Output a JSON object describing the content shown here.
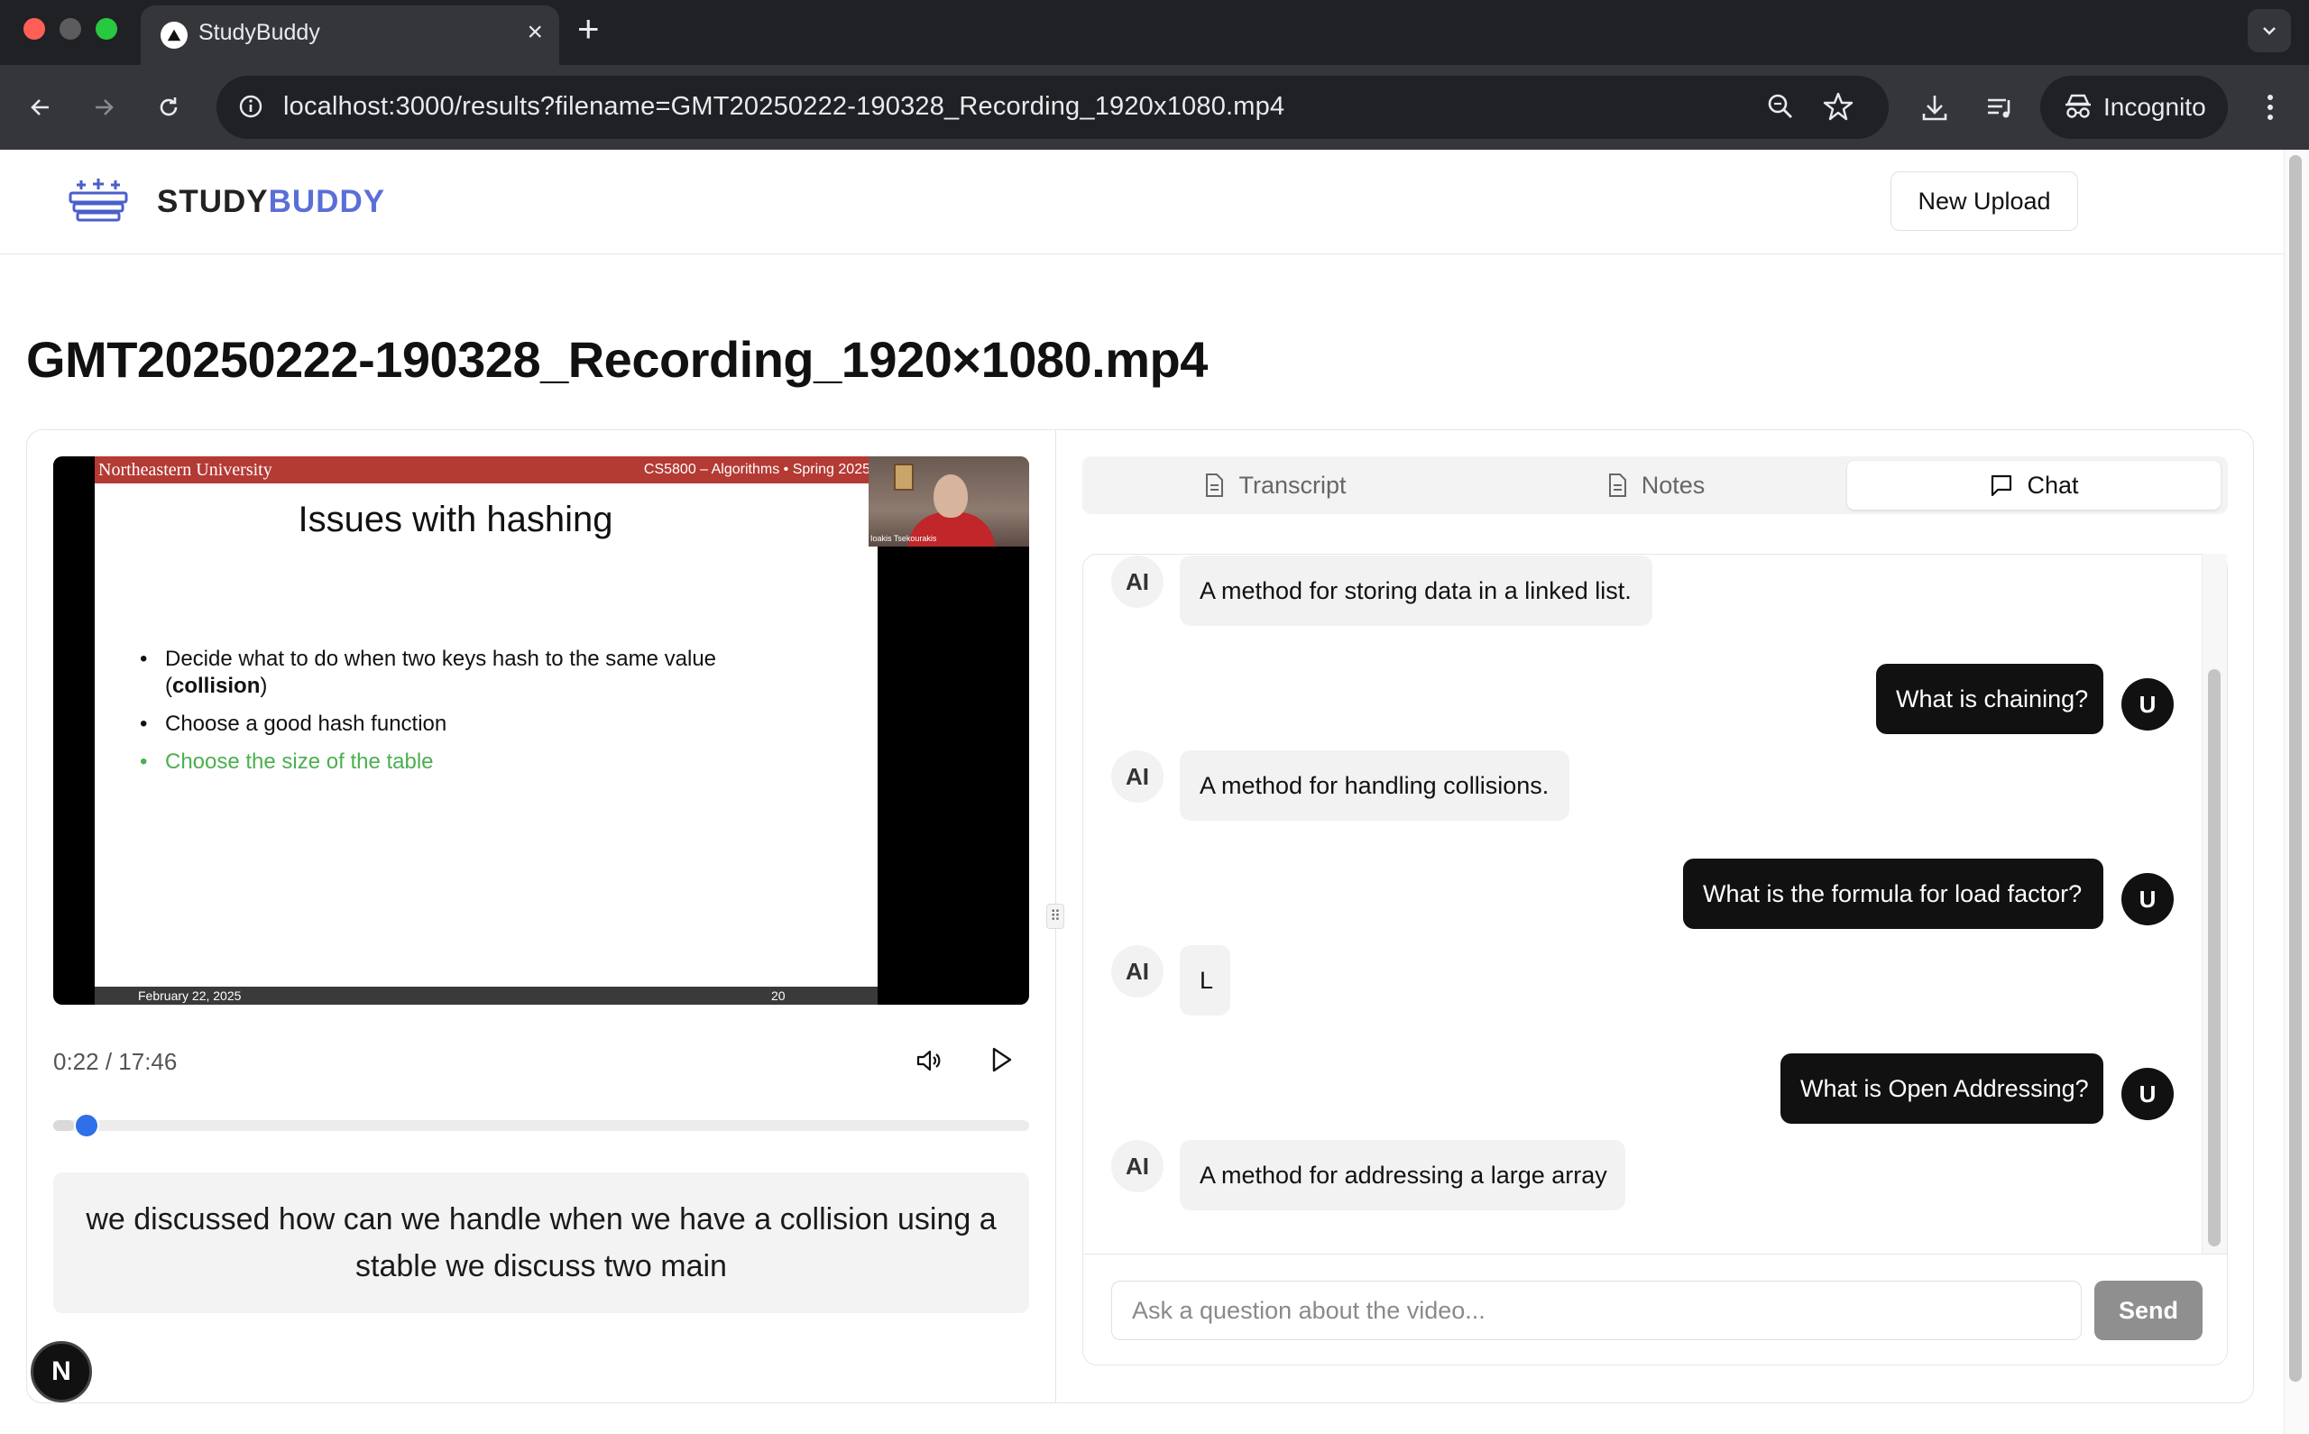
{
  "browser": {
    "tab_title": "StudyBuddy",
    "url": "localhost:3000/results?filename=GMT20250222-190328_Recording_1920x1080.mp4",
    "profile_label": "Incognito"
  },
  "header": {
    "brand_part1": "STUDY",
    "brand_part2": "BUDDY",
    "new_upload_label": "New Upload"
  },
  "page": {
    "title": "GMT20250222-190328_Recording_1920×1080.mp4"
  },
  "video": {
    "slide": {
      "university": "Northeastern University",
      "course": "CS5800 – Algorithms   •   Spring 2025",
      "title": "Issues with hashing",
      "bullet1_prefix": "Decide what to do when two keys hash to the same value (",
      "bullet1_bold": "collision",
      "bullet1_suffix": ")",
      "bullet2": "Choose a good hash function",
      "bullet3": "Choose the size of the table",
      "date": "February 22, 2025",
      "page_number": "20"
    },
    "webcam_label": "Ioakis Tsekourakis",
    "time_display": "0:22 / 17:46",
    "progress_fraction": 0.021,
    "caption": "we discussed how can we handle when we have a collision using a stable we discuss two main"
  },
  "tabs": {
    "transcript": "Transcript",
    "notes": "Notes",
    "chat": "Chat",
    "active": "chat"
  },
  "chat": {
    "messages": [
      {
        "role": "ai",
        "avatar": "AI",
        "text": "A method for storing data in a linked list."
      },
      {
        "role": "user",
        "avatar": "U",
        "text": "What is chaining?"
      },
      {
        "role": "ai",
        "avatar": "AI",
        "text": "A method for handling collisions."
      },
      {
        "role": "user",
        "avatar": "U",
        "text": "What is the formula for load factor?"
      },
      {
        "role": "ai",
        "avatar": "AI",
        "text": "L"
      },
      {
        "role": "user",
        "avatar": "U",
        "text": "What is Open Addressing?"
      },
      {
        "role": "ai",
        "avatar": "AI",
        "text": "A method for addressing a large array"
      }
    ],
    "input_placeholder": "Ask a question about the video...",
    "send_label": "Send"
  },
  "dev_badge": "N",
  "colors": {
    "brand_accent": "#5a6fd6",
    "progress_thumb": "#2f6fe8",
    "slide_header": "#b43a34",
    "highlight_bullet": "#4caf50"
  }
}
